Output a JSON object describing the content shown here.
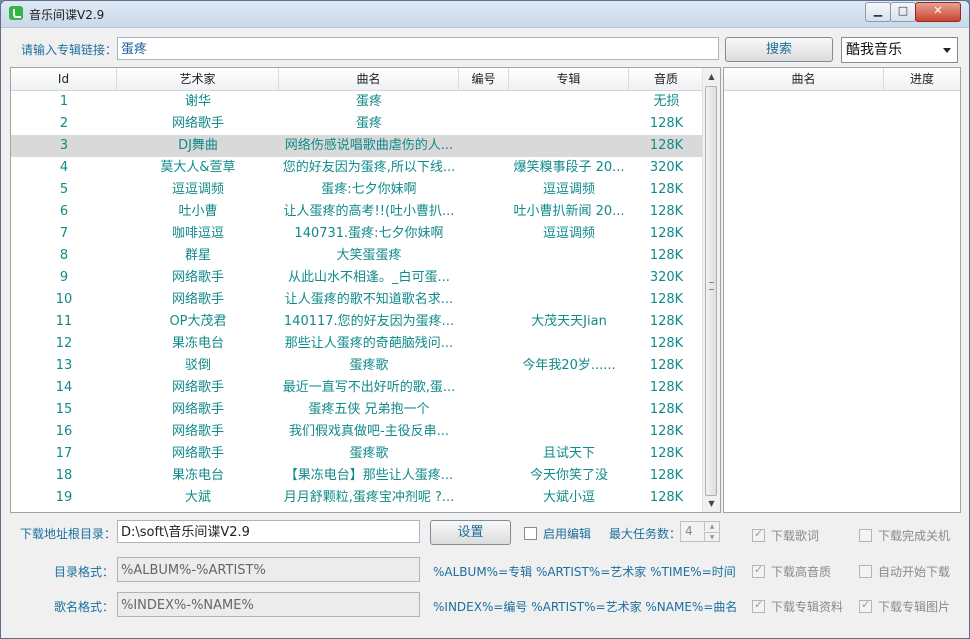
{
  "window": {
    "title": "音乐间谍V2.9",
    "min": "▁",
    "max": "□",
    "close": "✕"
  },
  "search": {
    "label": "请输入专辑链接：",
    "value": "蛋疼",
    "button": "搜索",
    "source": "酷我音乐"
  },
  "table": {
    "headers": [
      "Id",
      "艺术家",
      "曲名",
      "编号",
      "专辑",
      "音质"
    ],
    "rows": [
      [
        "1",
        "谢华",
        "蛋疼",
        "",
        "",
        "无损"
      ],
      [
        "2",
        "网络歌手",
        "蛋疼",
        "",
        "",
        "128K"
      ],
      [
        "3",
        "DJ舞曲",
        "网络伤感说唱歌曲虐伤的人...",
        "",
        "",
        "128K"
      ],
      [
        "4",
        "莫大人&萱草",
        "您的好友因为蛋疼,所以下线...",
        "",
        "爆笑糗事段子 20...",
        "320K"
      ],
      [
        "5",
        "逗逗调频",
        "蛋疼:七夕你妹啊",
        "",
        "逗逗调频",
        "128K"
      ],
      [
        "6",
        "吐小曹",
        "让人蛋疼的高考!!(吐小曹扒...",
        "",
        "吐小曹扒新闻 20...",
        "128K"
      ],
      [
        "7",
        "咖啡逗逗",
        "140731.蛋疼:七夕你妹啊",
        "",
        "逗逗调频",
        "128K"
      ],
      [
        "8",
        "群星",
        "大笑蛋蛋疼",
        "",
        "",
        "128K"
      ],
      [
        "9",
        "网络歌手",
        "从此山水不相逢。_白可蛋...",
        "",
        "",
        "320K"
      ],
      [
        "10",
        "网络歌手",
        "让人蛋疼的歌不知道歌名求...",
        "",
        "",
        "128K"
      ],
      [
        "11",
        "OP大茂君",
        "140117.您的好友因为蛋疼...",
        "",
        "大茂天天Jian",
        "128K"
      ],
      [
        "12",
        "果冻电台",
        "那些让人蛋疼的奇葩脑残问...",
        "",
        "",
        "128K"
      ],
      [
        "13",
        "驳倒",
        "蛋疼歌",
        "",
        "今年我20岁......",
        "128K"
      ],
      [
        "14",
        "网络歌手",
        "最近一直写不出好听的歌,蛋...",
        "",
        "",
        "128K"
      ],
      [
        "15",
        "网络歌手",
        "蛋疼五侠 兄弟抱一个",
        "",
        "",
        "128K"
      ],
      [
        "16",
        "网络歌手",
        "我们假戏真做吧-主役反串...",
        "",
        "",
        "128K"
      ],
      [
        "17",
        "网络歌手",
        "蛋疼歌",
        "",
        "且试天下",
        "128K"
      ],
      [
        "18",
        "果冻电台",
        "【果冻电台】那些让人蛋疼...",
        "",
        "今天你笑了没",
        "128K"
      ],
      [
        "19",
        "大斌",
        "月月舒颗粒,蛋疼宝冲剂呢 ?...",
        "",
        "大斌小逗",
        "128K"
      ]
    ],
    "selected_row": 3
  },
  "download_table": {
    "headers": [
      "曲名",
      "进度"
    ]
  },
  "settings": {
    "root_label": "下载地址根目录：",
    "root_value": "D:\\soft\\音乐间谍V2.9",
    "set_button": "设置",
    "enable_edit": "启用编辑",
    "max_tasks_label": "最大任务数：",
    "max_tasks_value": "4",
    "dir_format_label": "目录格式：",
    "dir_format_value": "%ALBUM%-%ARTIST%",
    "dir_format_hint": "%ALBUM%=专辑 %ARTIST%=艺术家 %TIME%=时间",
    "name_format_label": "歌名格式：",
    "name_format_value": "%INDEX%-%NAME%",
    "name_format_hint": "%INDEX%=编号 %ARTIST%=艺术家 %NAME%=曲名",
    "checks": {
      "lyrics": "下载歌词",
      "shutdown": "下载完成关机",
      "hq": "下载高音质",
      "autostart": "自动开始下载",
      "album_info": "下载专辑资料",
      "album_pic": "下载专辑图片"
    }
  }
}
